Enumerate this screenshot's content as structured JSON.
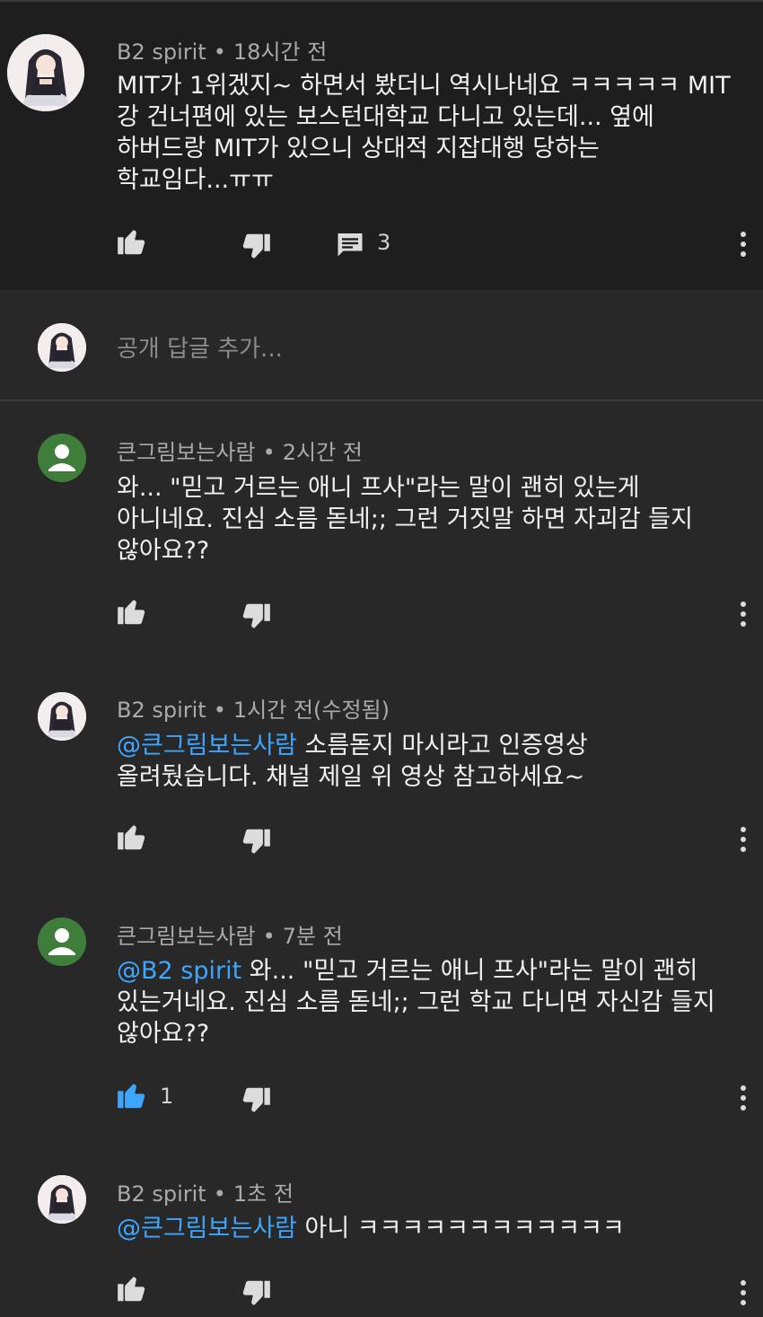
{
  "top_comment": {
    "author": "B2 spirit",
    "time": "18시간 전",
    "lines": [
      "MIT가 1위겠지~ 하면서 봤더니 역시나네요 ㅋㅋㅋㅋㅋ MIT",
      "강 건너편에 있는 보스턴대학교 다니고 있는데... 옆에",
      "하버드랑 MIT가 있으니 상대적 지잡대행 당하는",
      "학교임다...ㅠㅠ"
    ],
    "reply_count": "3",
    "icons": [
      "like-icon",
      "dislike-icon",
      "comment-icon",
      "more-vert-icon"
    ]
  },
  "reply_input": {
    "placeholder": "공개 답글 추가..."
  },
  "replies": [
    {
      "author": "큰그림보는사람",
      "time": "2시간 전",
      "mention": "",
      "lines": [
        "와... \"믿고 거르는 애니 프사\"라는 말이 괜히 있는게",
        "아니네요. 진심 소름 돋네;; 그런 거짓말 하면 자괴감 들지",
        "않아요??"
      ],
      "likes": ""
    },
    {
      "author": "B2 spirit",
      "time": "1시간 전(수정됨)",
      "mention": "@큰그림보는사람",
      "lines": [
        " 소름돋지 마시라고 인증영상",
        "올려뒀습니다. 채널 제일 위 영상 참고하세요~"
      ],
      "likes": ""
    },
    {
      "author": "큰그림보는사람",
      "time": "7분 전",
      "mention": "@B2 spirit",
      "lines": [
        " 와... \"믿고 거르는 애니 프사\"라는 말이 괜히",
        "있는거네요. 진심 소름 돋네;; 그런 학교 다니면 자신감 들지",
        "않아요??"
      ],
      "likes": "1"
    },
    {
      "author": "B2 spirit",
      "time": "1초 전",
      "mention": "@큰그림보는사람",
      "lines": [
        " 아니 ㅋㅋㅋㅋㅋㅋㅋㅋㅋㅋㅋㅋ"
      ],
      "likes": ""
    }
  ],
  "colors": {
    "background": "#282828",
    "top_comment_background": "#1e1e1e",
    "mention": "#3ea6ff",
    "liked": "#3ea6ff",
    "meta": "#aaaaaa"
  }
}
